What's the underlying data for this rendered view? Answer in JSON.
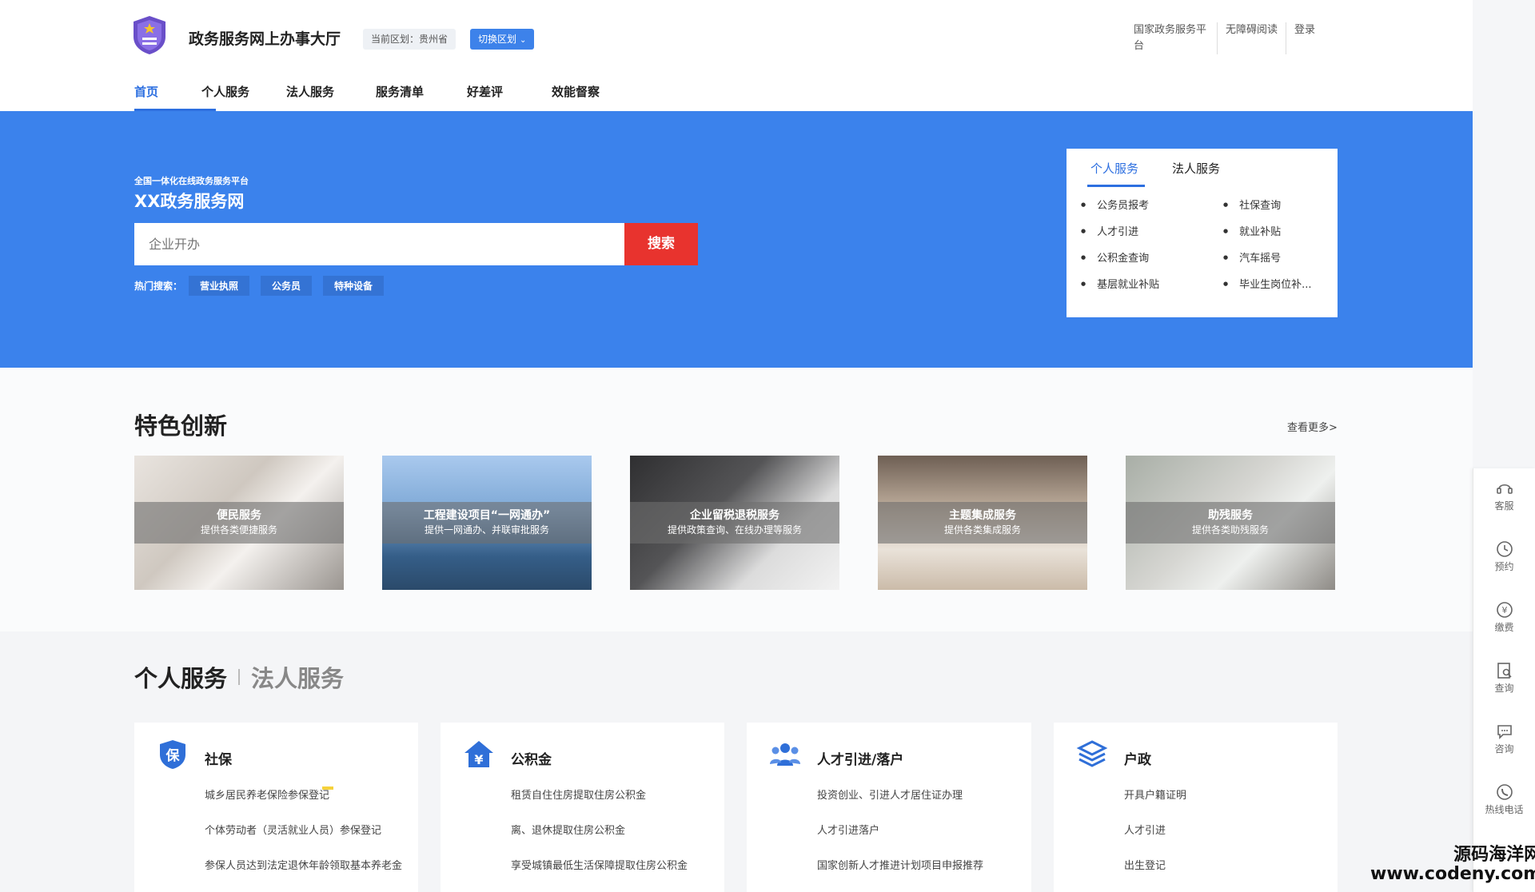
{
  "header": {
    "site_title": "政务服务网上办事大厅",
    "region_current": "当前区划：贵州省",
    "region_switch": "切换区划",
    "top_links": [
      "国家政务服务平台",
      "无障碍阅读",
      "登录"
    ]
  },
  "nav": {
    "items": [
      "首页",
      "个人服务",
      "法人服务",
      "服务清单",
      "好差评",
      "效能督察"
    ],
    "active": "首页"
  },
  "hero": {
    "subtitle": "全国一体化在线政务服务平台",
    "title": "XX政务服务网",
    "search_placeholder": "企业开办",
    "search_button": "搜索",
    "hot_label": "热门搜索：",
    "hot_tags": [
      "营业执照",
      "公务员",
      "特种设备"
    ],
    "panel": {
      "tabs": [
        "个人服务",
        "法人服务"
      ],
      "items": [
        "公务员报考",
        "社保查询",
        "人才引进",
        "就业补贴",
        "公积金查询",
        "汽车摇号",
        "基层就业补贴",
        "毕业生岗位补..."
      ]
    }
  },
  "feature": {
    "title": "特色创新",
    "more": "查看更多>",
    "cards": [
      {
        "title": "便民服务",
        "desc": "提供各类便捷服务"
      },
      {
        "title": "工程建设项目“一网通办”",
        "desc": "提供一网通办、并联审批服务"
      },
      {
        "title": "企业留税退税服务",
        "desc": "提供政策查询、在线办理等服务"
      },
      {
        "title": "主题集成服务",
        "desc": "提供各类集成服务"
      },
      {
        "title": "助残服务",
        "desc": "提供各类助残服务"
      }
    ]
  },
  "personal": {
    "tab_active": "个人服务",
    "tab_inactive": "法人服务",
    "cards": [
      {
        "icon": "shield-bao-icon",
        "title": "社保",
        "links": [
          "城乡居民养老保险参保登记",
          "个体劳动者（灵活就业人员）参保登记",
          "参保人员达到法定退休年龄领取基本养老金"
        ],
        "badge": "1"
      },
      {
        "icon": "yuan-house-icon",
        "title": "公积金",
        "links": [
          "租赁自住住房提取住房公积金",
          "离、退休提取住房公积金",
          "享受城镇最低生活保障提取住房公积金"
        ]
      },
      {
        "icon": "people-icon",
        "title": "人才引进/落户",
        "links": [
          "投资创业、引进人才居住证办理",
          "人才引进落户",
          "国家创新人才推进计划项目申报推荐"
        ]
      },
      {
        "icon": "layers-icon",
        "title": "户政",
        "links": [
          "开具户籍证明",
          "人才引进",
          "出生登记"
        ]
      }
    ]
  },
  "dock": {
    "items": [
      {
        "icon": "headset-icon",
        "label": "客服"
      },
      {
        "icon": "clock-icon",
        "label": "预约"
      },
      {
        "icon": "yuan-icon",
        "label": "缴费"
      },
      {
        "icon": "search-doc-icon",
        "label": "查询"
      },
      {
        "icon": "chat-icon",
        "label": "咨询"
      },
      {
        "icon": "phone-icon",
        "label": "热线电话"
      }
    ]
  },
  "watermark": {
    "line1": "源码海洋网",
    "line2": "www.codeny.com"
  },
  "colors": {
    "primary": "#3b82ec",
    "accent_red": "#e8332e",
    "nav_active": "#2d6fe0"
  }
}
